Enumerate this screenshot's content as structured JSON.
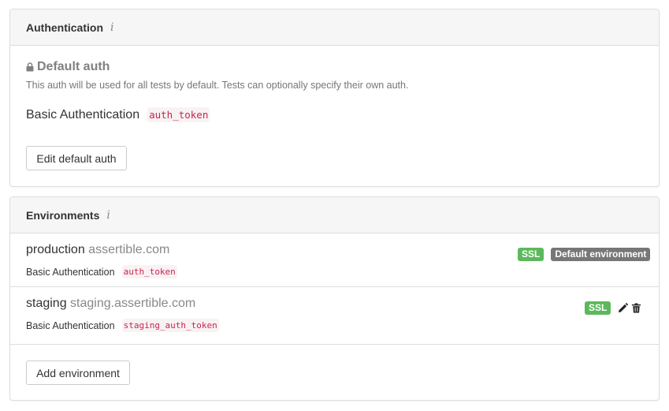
{
  "auth_panel": {
    "title": "Authentication",
    "info_glyph": "i",
    "default_auth": {
      "title": "Default auth",
      "description": "This auth will be used for all tests by default. Tests can optionally specify their own auth.",
      "auth_type": "Basic Authentication",
      "auth_name": "auth_token"
    },
    "edit_button": "Edit default auth"
  },
  "env_panel": {
    "title": "Environments",
    "info_glyph": "i",
    "environments": [
      {
        "name": "production",
        "host": "assertible.com",
        "auth_type": "Basic Authentication",
        "auth_name": "auth_token",
        "ssl_badge": "SSL",
        "default_badge": "Default environment"
      },
      {
        "name": "staging",
        "host": "staging.assertible.com",
        "auth_type": "Basic Authentication",
        "auth_name": "staging_auth_token",
        "ssl_badge": "SSL"
      }
    ],
    "add_button": "Add environment"
  },
  "colors": {
    "ssl_badge": "#5cb85c",
    "default_badge": "#777777",
    "code_text": "#c7254e",
    "code_bg": "#f9f2f4",
    "header_bg": "#f6f6f6",
    "border": "#dddddd"
  },
  "icons": [
    "info-icon",
    "lock-icon",
    "pencil-icon",
    "trash-icon"
  ]
}
